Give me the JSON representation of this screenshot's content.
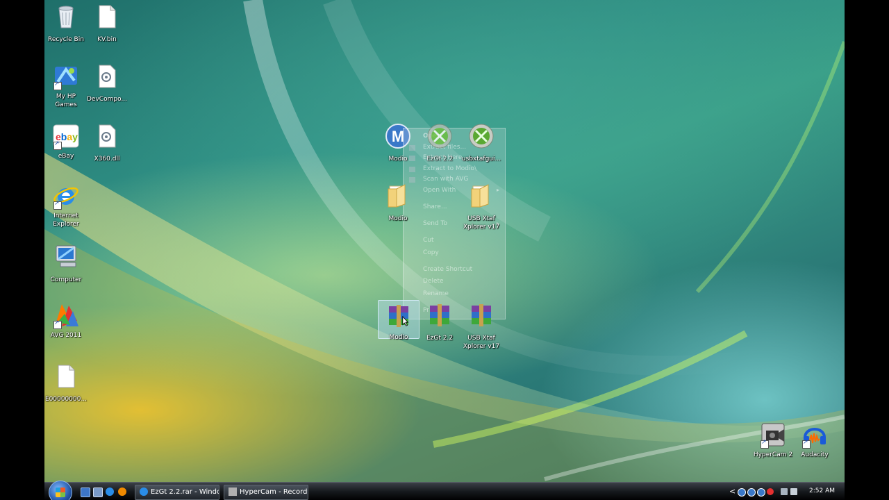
{
  "desktop": {
    "left_icons": [
      {
        "label": "Recycle Bin",
        "icon": "recycle-bin-icon"
      },
      {
        "label": "KV.bin",
        "icon": "file-icon"
      },
      {
        "label": "My HP Games",
        "icon": "games-icon"
      },
      {
        "label": "DevCompo...",
        "icon": "dll-file-icon"
      },
      {
        "label": "eBay",
        "icon": "ebay-icon"
      },
      {
        "label": "X360.dll",
        "icon": "dll-file-icon"
      },
      {
        "label": "Internet Explorer",
        "icon": "internet-explorer-icon"
      },
      {
        "label": "Computer",
        "icon": "computer-icon"
      },
      {
        "label": "AVG 2011",
        "icon": "avg-icon"
      },
      {
        "label": "E00000000...",
        "icon": "file-icon"
      }
    ],
    "middle_icons": [
      {
        "label": "Modio",
        "icon": "modio-app-icon"
      },
      {
        "label": "EzGt 2.2",
        "icon": "xbox-icon"
      },
      {
        "label": "usbxtafgui...",
        "icon": "xbox-icon"
      },
      {
        "label": "Modio",
        "icon": "folder-icon"
      },
      {
        "label": "USB Xtaf Xplorer v17",
        "icon": "folder-icon"
      },
      {
        "label": "Modio",
        "icon": "winrar-archive-icon"
      },
      {
        "label": "EzGt 2.2",
        "icon": "winrar-archive-icon"
      },
      {
        "label": "USB Xtaf Xplorer v17",
        "icon": "winrar-archive-icon"
      }
    ],
    "right_icons": [
      {
        "label": "HyperCam 2",
        "icon": "hypercam-icon"
      },
      {
        "label": "Audacity",
        "icon": "audacity-icon"
      }
    ]
  },
  "context_menu": {
    "items": [
      "Open",
      "Extract files...",
      "Extract Here",
      "Extract to Modio\\",
      "Scan with AVG",
      "Open With",
      "Share...",
      "Send To",
      "Cut",
      "Copy",
      "Create Shortcut",
      "Delete",
      "Rename",
      "Pr"
    ]
  },
  "taskbar": {
    "buttons": [
      {
        "label": "EzGt 2.2.rar - Windo...",
        "icon": "ie-icon"
      },
      {
        "label": "HyperCam - Record...",
        "icon": "hypercam-icon"
      }
    ],
    "clock": "2:52 AM",
    "tray_chevron": "<"
  },
  "colors": {
    "taskbar": "#15181c",
    "wallpaper_teal": "#2f8f84",
    "wallpaper_yellow": "#ffc828"
  }
}
